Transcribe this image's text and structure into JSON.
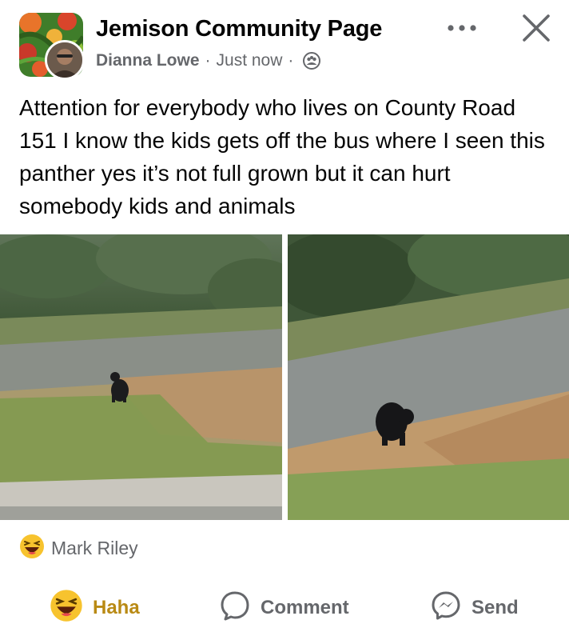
{
  "post": {
    "group_name": "Jemison Community  Page",
    "author": "Dianna Lowe",
    "separator": "·",
    "time": "Just now",
    "privacy_icon": "group-icon",
    "text": "Attention for everybody who lives on County Road 151 I know the kids gets off the bus where I seen this panther yes it’s not full grown but it can hurt somebody kids and animals",
    "photos": [
      {
        "content": "black panther cub standing on dirt roadside beside a paved road, wide shot"
      },
      {
        "content": "black panther cub standing on dirt roadside beside a paved road, closer shot"
      }
    ]
  },
  "reactions": {
    "icon": "haha-emoji-icon",
    "reactor_name": "Mark Riley"
  },
  "actions": {
    "haha_label": "Haha",
    "comment_label": "Comment",
    "send_label": "Send"
  },
  "header_controls": {
    "more_icon": "more-options-icon",
    "close_icon": "close-icon"
  },
  "colors": {
    "secondary_text": "#65676b",
    "haha_active": "#b98a14",
    "primary_text": "#050505"
  }
}
